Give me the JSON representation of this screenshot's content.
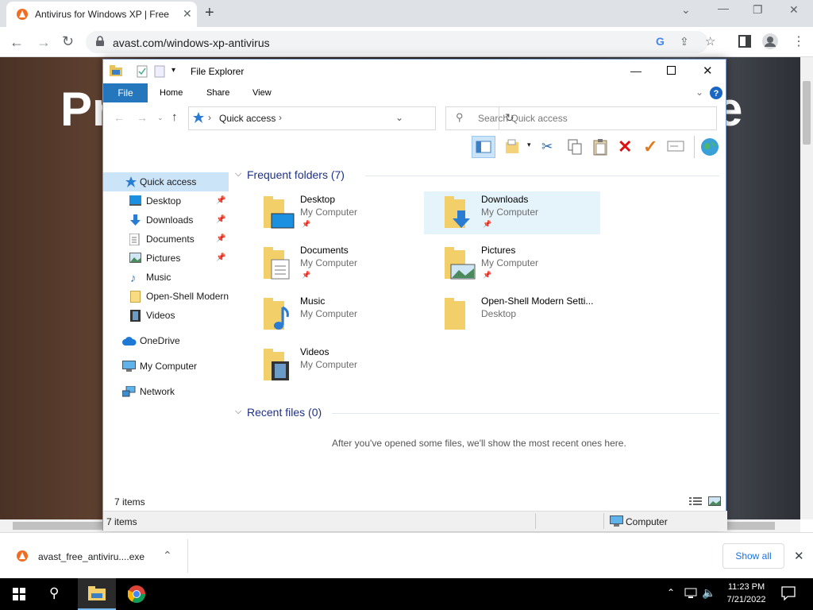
{
  "browser": {
    "tab_title": "Antivirus for Windows XP | Free",
    "url": "avast.com/windows-xp-antivirus",
    "page_headline_left": "Pr",
    "page_headline_right": "e"
  },
  "explorer": {
    "title": "File Explorer",
    "ribbon_tabs": [
      "File",
      "Home",
      "Share",
      "View"
    ],
    "address": "Quick access",
    "search_placeholder": "Search Quick access",
    "nav": {
      "quick_access": "Quick access",
      "items": [
        "Desktop",
        "Downloads",
        "Documents",
        "Pictures",
        "Music",
        "Open-Shell Modern",
        "Videos"
      ],
      "onedrive": "OneDrive",
      "my_computer": "My Computer",
      "network": "Network"
    },
    "frequent_header": "Frequent folders (7)",
    "folders": [
      {
        "name": "Desktop",
        "location": "My Computer"
      },
      {
        "name": "Downloads",
        "location": "My Computer"
      },
      {
        "name": "Documents",
        "location": "My Computer"
      },
      {
        "name": "Pictures",
        "location": "My Computer"
      },
      {
        "name": "Music",
        "location": "My Computer"
      },
      {
        "name": "Open-Shell Modern Setti...",
        "location": "Desktop"
      },
      {
        "name": "Videos",
        "location": "My Computer"
      }
    ],
    "recent_header": "Recent files (0)",
    "recent_empty": "After you've opened some files, we'll show the most recent ones here.",
    "item_count": "7 items",
    "status_count": "7 items",
    "status_location": "Computer"
  },
  "downloads": {
    "file": "avast_free_antiviru....exe",
    "show_all": "Show all"
  },
  "taskbar": {
    "time": "11:23 PM",
    "date": "7/21/2022"
  },
  "colors": {
    "accent": "#2577bd",
    "avast_orange": "#f36d21"
  }
}
